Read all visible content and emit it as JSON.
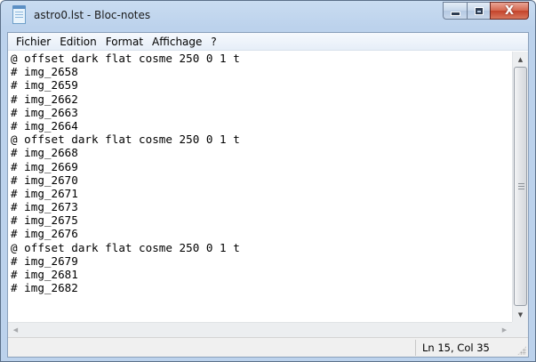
{
  "window": {
    "title": "astro0.lst - Bloc-notes",
    "close_glyph": "X"
  },
  "menu": [
    "Fichier",
    "Edition",
    "Format",
    "Affichage",
    "?"
  ],
  "editor": {
    "lines": [
      "@ offset dark flat cosme 250 0 1 t",
      "# img_2658",
      "# img_2659",
      "# img_2662",
      "# img_2663",
      "# img_2664",
      "@ offset dark flat cosme 250 0 1 t",
      "# img_2668",
      "# img_2669",
      "# img_2670",
      "# img_2671",
      "# img_2673",
      "# img_2675",
      "# img_2676",
      "@ offset dark flat cosme 250 0 1 t",
      "# img_2679",
      "# img_2681",
      "# img_2682"
    ]
  },
  "status": {
    "cursor_position": "Ln 15, Col 35"
  },
  "colors": {
    "titlebar": "#bcd2ec",
    "close_button": "#c4432b",
    "text": "#000000"
  }
}
